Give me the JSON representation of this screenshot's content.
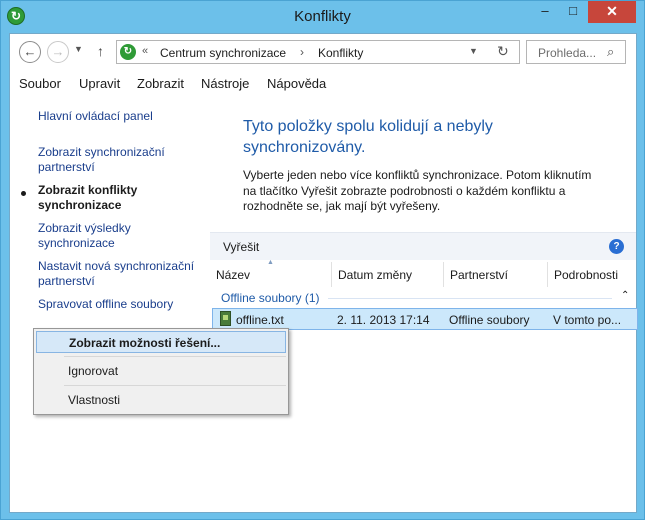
{
  "window": {
    "title": "Konflikty"
  },
  "navigation": {
    "address_crumbs": [
      "Centrum synchronizace",
      "Konflikty"
    ],
    "address_prefix": "«",
    "address_separator": "›",
    "search_placeholder": "Prohleda..."
  },
  "menubar": {
    "items": [
      "Soubor",
      "Upravit",
      "Zobrazit",
      "Nástroje",
      "Nápověda"
    ]
  },
  "sidebar": {
    "items": [
      {
        "label": "Hlavní ovládací panel"
      },
      {
        "label": "Zobrazit synchronizační partnerství"
      },
      {
        "label": "Zobrazit konflikty synchronizace",
        "active": true
      },
      {
        "label": "Zobrazit výsledky synchronizace"
      },
      {
        "label": "Nastavit nová synchronizační partnerství"
      },
      {
        "label": "Spravovat offline soubory"
      }
    ]
  },
  "main": {
    "heading": "Tyto položky spolu kolidují a nebyly synchronizovány.",
    "description": "Vyberte jeden nebo více konfliktů synchronizace. Potom kliknutím na tlačítko Vyřešit zobrazte podrobnosti o každém konfliktu a rozhodněte se, jak mají být vyřešeny."
  },
  "listbar": {
    "resolve_label": "Vyřešit",
    "help_icon": "?"
  },
  "table": {
    "columns": [
      "Název",
      "Datum změny",
      "Partnerství",
      "Podrobnosti"
    ],
    "group_label": "Offline soubory (1)",
    "rows": [
      {
        "name": "offline.txt",
        "date": "2. 11. 2013 17:14",
        "partnership": "Offline soubory",
        "details": "V tomto po..."
      }
    ]
  },
  "context_menu": {
    "items": [
      "Zobrazit možnosti řešení...",
      "Ignorovat",
      "Vlastnosti"
    ]
  },
  "colors": {
    "frame": "#6cc0ea",
    "close_button": "#c7463b",
    "heading": "#1f5ba8",
    "link": "#1a3e8c",
    "selection": "#cce8fb"
  }
}
